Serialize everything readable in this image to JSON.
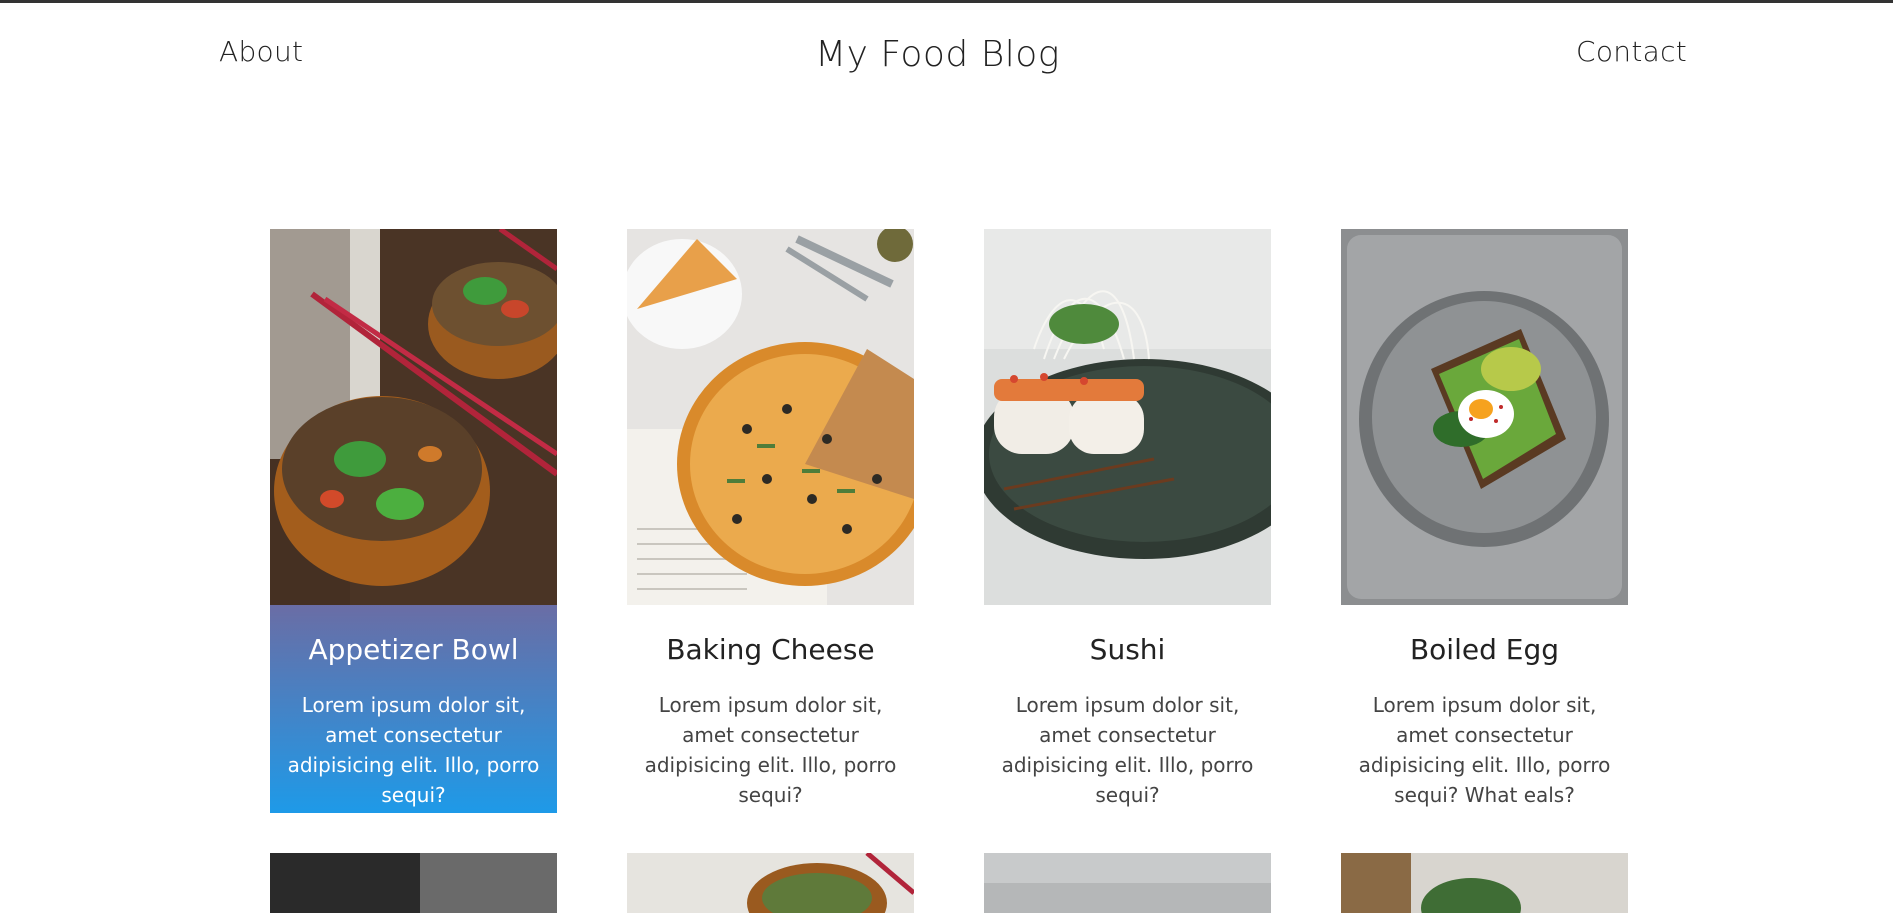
{
  "nav": {
    "about": "About",
    "title": "My Food Blog",
    "contact": "Contact"
  },
  "cards": [
    {
      "title": "Appetizer Bowl",
      "desc": "Lorem ipsum dolor sit, amet consectetur adipisicing elit. Illo, porro sequi?",
      "image": "noodle-bowls-image",
      "active": true
    },
    {
      "title": "Baking Cheese",
      "desc": "Lorem ipsum dolor sit, amet consectetur adipisicing elit. Illo, porro sequi?",
      "image": "pizza-image",
      "active": false
    },
    {
      "title": "Sushi",
      "desc": "Lorem ipsum dolor sit, amet consectetur adipisicing elit. Illo, porro sequi?",
      "image": "sushi-image",
      "active": false
    },
    {
      "title": "Boiled Egg",
      "desc": "Lorem ipsum dolor sit, amet consectetur adipisicing elit. Illo, porro sequi? What eals?",
      "image": "egg-toast-image",
      "active": false
    }
  ],
  "colors": {
    "active_gradient_top": "#6a6da5",
    "active_gradient_bottom": "#1e9ae8",
    "text": "#222222"
  }
}
